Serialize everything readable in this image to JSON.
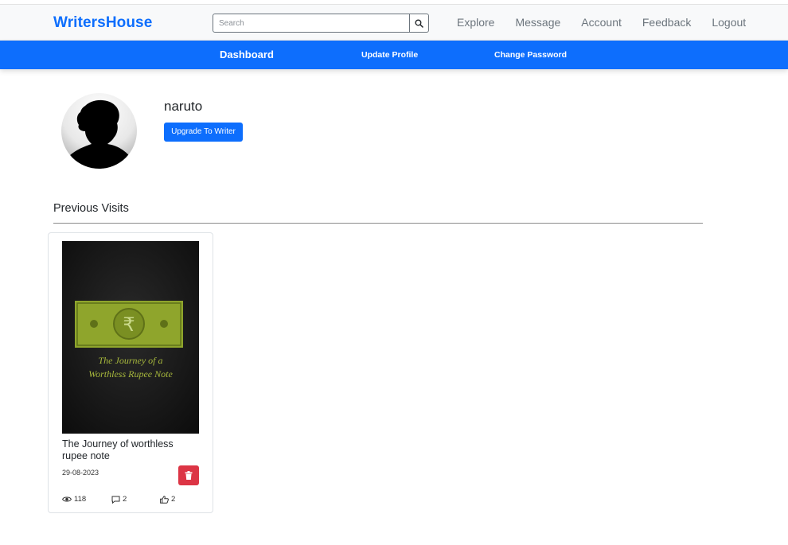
{
  "app": {
    "brand": "WritersHouse"
  },
  "search": {
    "placeholder": "Search",
    "value": ""
  },
  "nav": {
    "links": [
      "Explore",
      "Message",
      "Account",
      "Feedback",
      "Logout"
    ]
  },
  "subnav": {
    "items": [
      "Dashboard",
      "Update Profile",
      "Change Password"
    ],
    "active": "Dashboard"
  },
  "profile": {
    "username": "naruto",
    "upgrade_label": "Upgrade To Writer"
  },
  "section": {
    "title": "Previous Visits"
  },
  "visits": [
    {
      "title": "The Journey of worthless rupee note",
      "date": "29-08-2023",
      "views": "118",
      "comments": "2",
      "likes": "2",
      "cover_text_line1": "The Journey of a",
      "cover_text_line2": "Worthless Rupee Note",
      "cover_symbol": "₹"
    }
  ],
  "colors": {
    "primary": "#0d6efd",
    "danger": "#dc3545",
    "navbar_bg": "#f8f9fa",
    "cover_green": "#8fa52c"
  },
  "icons": {
    "search": "search-icon",
    "delete": "trash-icon",
    "views": "eye-icon",
    "comments": "comment-icon",
    "likes": "thumbs-up-icon"
  }
}
